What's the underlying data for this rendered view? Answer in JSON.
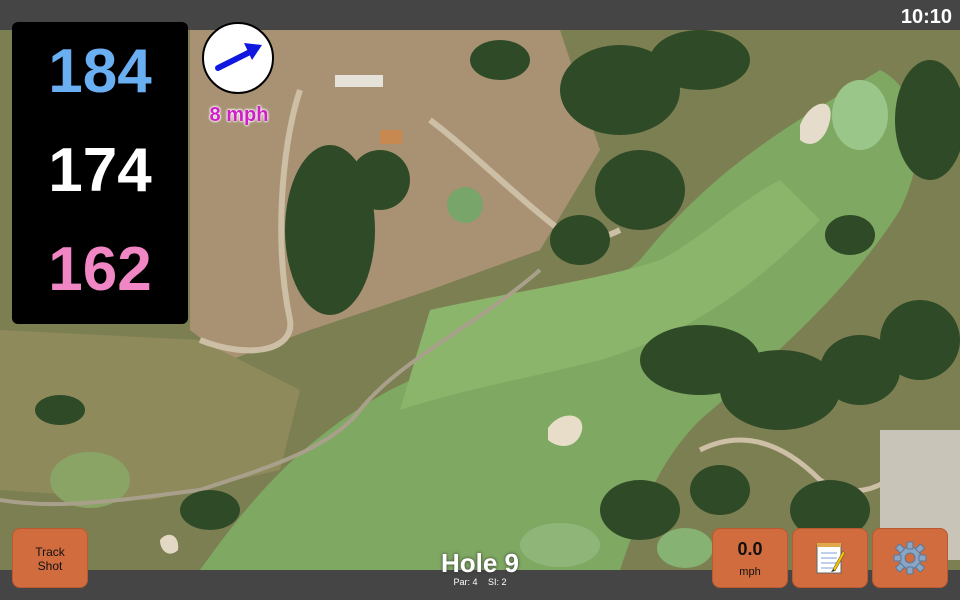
{
  "status_bar": {
    "time": "10:10"
  },
  "distances": {
    "back": "184",
    "middle": "174",
    "front": "162"
  },
  "wind": {
    "speed_label": "8 mph",
    "direction": "arrow-icon-northeast"
  },
  "track_button": {
    "line1": "Track",
    "line2": "Shot"
  },
  "hole": {
    "title": "Hole 9",
    "par_label": "Par: 4",
    "si_label": "SI: 2"
  },
  "speed_button": {
    "value": "0.0",
    "unit": "mph"
  },
  "notes_button": {
    "icon": "notepad-icon"
  },
  "settings_button": {
    "icon": "gear-icon"
  },
  "colors": {
    "back": "#6aaff2",
    "middle": "#ffffff",
    "front": "#f087c4",
    "wind": "#cf1fc9",
    "button": "#d06c3e"
  }
}
